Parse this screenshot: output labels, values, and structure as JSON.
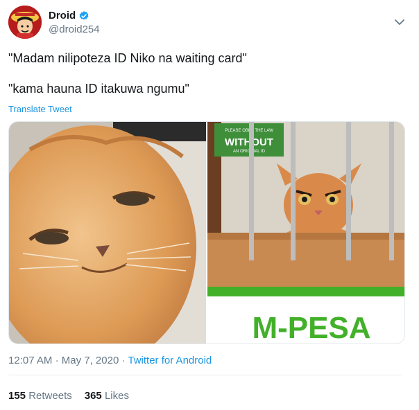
{
  "user": {
    "display_name": "Droid",
    "handle": "@droid254"
  },
  "tweet": {
    "line1": "\"Madam nilipoteza ID Niko na waiting card\"",
    "line2": "\"kama hauna ID itakuwa ngumu\"",
    "translate_label": "Translate Tweet"
  },
  "media": {
    "right_sign_text": "WITHOUT",
    "right_sign_small": "PLEASE OBEY THE LAW · NO TRANSACTION · AN ORIGINAL ID",
    "right_banner": "M-PESA"
  },
  "meta": {
    "time": "12:07 AM",
    "separator1": "·",
    "date": "May 7, 2020",
    "separator2": "·",
    "source": "Twitter for Android"
  },
  "stats": {
    "retweets_count": "155",
    "retweets_label": "Retweets",
    "likes_count": "365",
    "likes_label": "Likes"
  },
  "colors": {
    "link": "#1b95e0",
    "secondary": "#657786",
    "verified": "#1da1f2",
    "mpesa_green": "#43b02a"
  }
}
